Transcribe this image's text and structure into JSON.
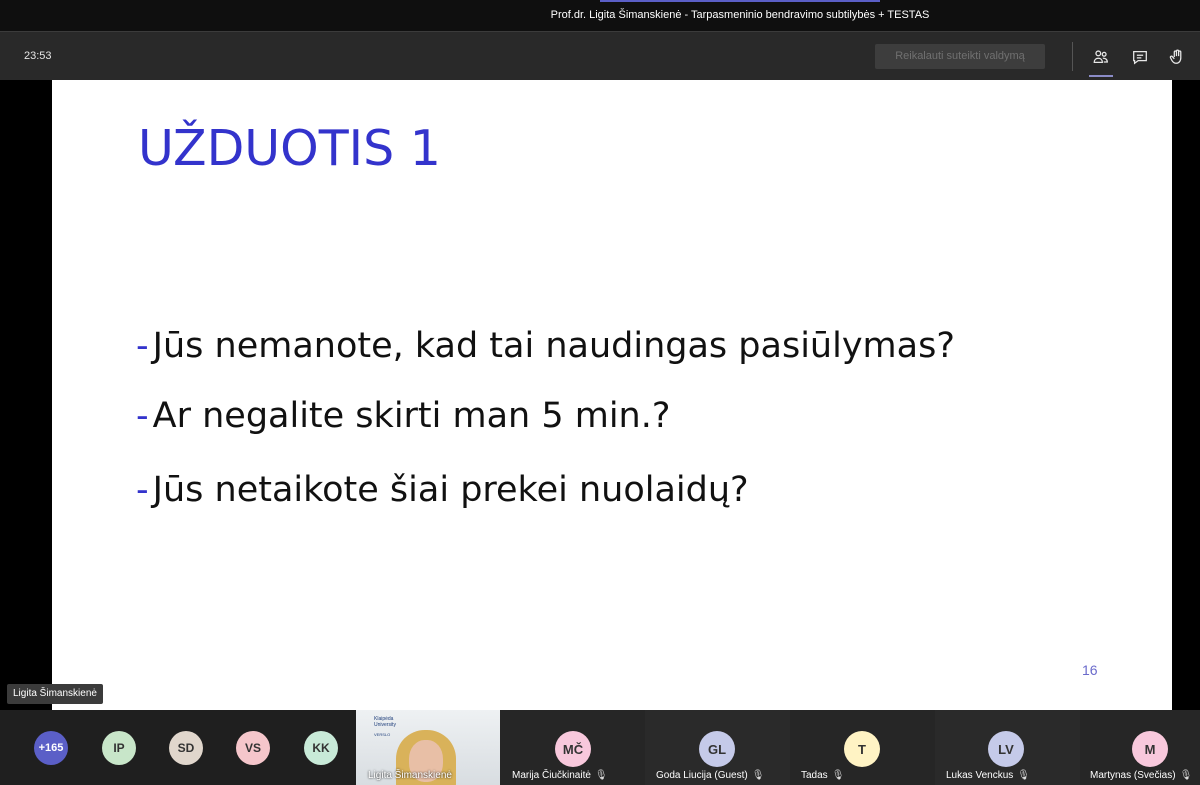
{
  "window": {
    "title": "Prof.dr. Ligita Šimanskienė - Tarpasmeninio bendravimo subtilybės + TESTAS"
  },
  "toolbar": {
    "timer": "23:53",
    "request_control_label": "Reikalauti suteikti valdymą",
    "icons": [
      "people-icon",
      "chat-icon",
      "raise-hand-icon"
    ]
  },
  "slide": {
    "title": "UŽDUOTIS 1",
    "bullet_marker": "-",
    "bullets": [
      "Jūs nemanote, kad tai naudingas pasiūlymas?",
      "Ar negalite skirti man 5 min.?",
      "Jūs netaikote šiai prekei nuolaidų?"
    ],
    "page_number": "16",
    "title_color": "#3333cc"
  },
  "presenter_label": "Ligita Šimanskienė",
  "participants": {
    "overflow_count": "+165",
    "bubbles": [
      {
        "initials": "IP",
        "color": "#c8e6c9"
      },
      {
        "initials": "SD",
        "color": "#e0d6cc"
      },
      {
        "initials": "VS",
        "color": "#f5c6cb"
      },
      {
        "initials": "KK",
        "color": "#c8ead8"
      }
    ],
    "overflow_color": "#5b5fc7",
    "video": {
      "name": "Ligita Šimanskienė",
      "logo_text": "Klaipėda University",
      "logo_subtext": "VERSLO"
    },
    "tiles": [
      {
        "initials": "MČ",
        "name": "Marija Čiučkinaitė",
        "color": "#f8c8dc"
      },
      {
        "initials": "GL",
        "name": "Goda Liucija (Guest)",
        "color": "#c5cae9"
      },
      {
        "initials": "T",
        "name": "Tadas",
        "color": "#fff3c4"
      },
      {
        "initials": "LV",
        "name": "Lukas Venckus",
        "color": "#c5cae9"
      },
      {
        "initials": "M",
        "name": "Martynas (Svečias)",
        "color": "#f8c8dc"
      }
    ],
    "mic_muted_glyph": "🎙"
  }
}
